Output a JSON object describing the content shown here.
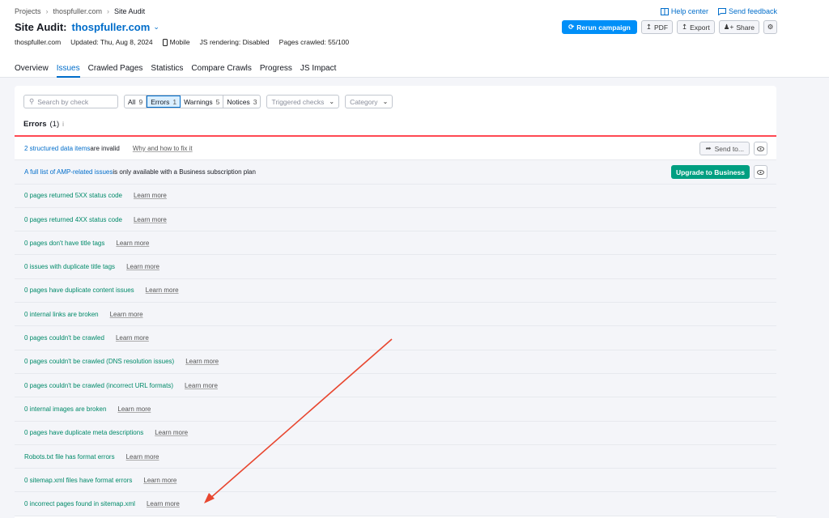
{
  "breadcrumb": {
    "items": [
      "Projects",
      "thospfuller.com",
      "Site Audit"
    ]
  },
  "help": {
    "help_center": "Help center",
    "send_feedback": "Send feedback"
  },
  "title": {
    "prefix": "Site Audit:",
    "domain": "thospfuller.com"
  },
  "actions": {
    "rerun": "Rerun campaign",
    "pdf": "PDF",
    "export": "Export",
    "share": "Share"
  },
  "meta": {
    "domain": "thospfuller.com",
    "updated": "Updated: Thu, Aug 8, 2024",
    "device": "Mobile",
    "js_rendering": "JS rendering: Disabled",
    "pages_crawled": "Pages crawled: 55/100"
  },
  "tabs": [
    "Overview",
    "Issues",
    "Crawled Pages",
    "Statistics",
    "Compare Crawls",
    "Progress",
    "JS Impact"
  ],
  "filters": {
    "search_placeholder": "Search by check",
    "all_label": "All",
    "all_count": "9",
    "errors_label": "Errors",
    "errors_count": "1",
    "warnings_label": "Warnings",
    "warnings_count": "5",
    "notices_label": "Notices",
    "notices_count": "3",
    "triggered": "Triggered checks",
    "category": "Category"
  },
  "section": {
    "title": "Errors",
    "count": "(1)",
    "info": "i"
  },
  "row1": {
    "link": "2 structured data items",
    "rest": " are invalid",
    "why": "Why and how to fix it",
    "send": "Send to..."
  },
  "row2": {
    "link": "A full list of AMP-related issues",
    "rest": " is only available with a Business subscription plan",
    "upgrade": "Upgrade to Business"
  },
  "learn_more": "Learn more",
  "issues": [
    "0 pages returned 5XX status code",
    "0 pages returned 4XX status code",
    "0 pages don't have title tags",
    "0 issues with duplicate title tags",
    "0 pages have duplicate content issues",
    "0 internal links are broken",
    "0 pages couldn't be crawled",
    "0 pages couldn't be crawled (DNS resolution issues)",
    "0 pages couldn't be crawled (incorrect URL formats)",
    "0 internal images are broken",
    "0 pages have duplicate meta descriptions",
    "Robots.txt file has format errors",
    "0 sitemap.xml files have format errors",
    "0 incorrect pages found in sitemap.xml"
  ],
  "colors": {
    "accent": "#006dca",
    "primary_button": "#008ff8",
    "error_line": "#ff4953",
    "issue_green": "#008a69",
    "annotation_arrow": "#e8462f"
  }
}
